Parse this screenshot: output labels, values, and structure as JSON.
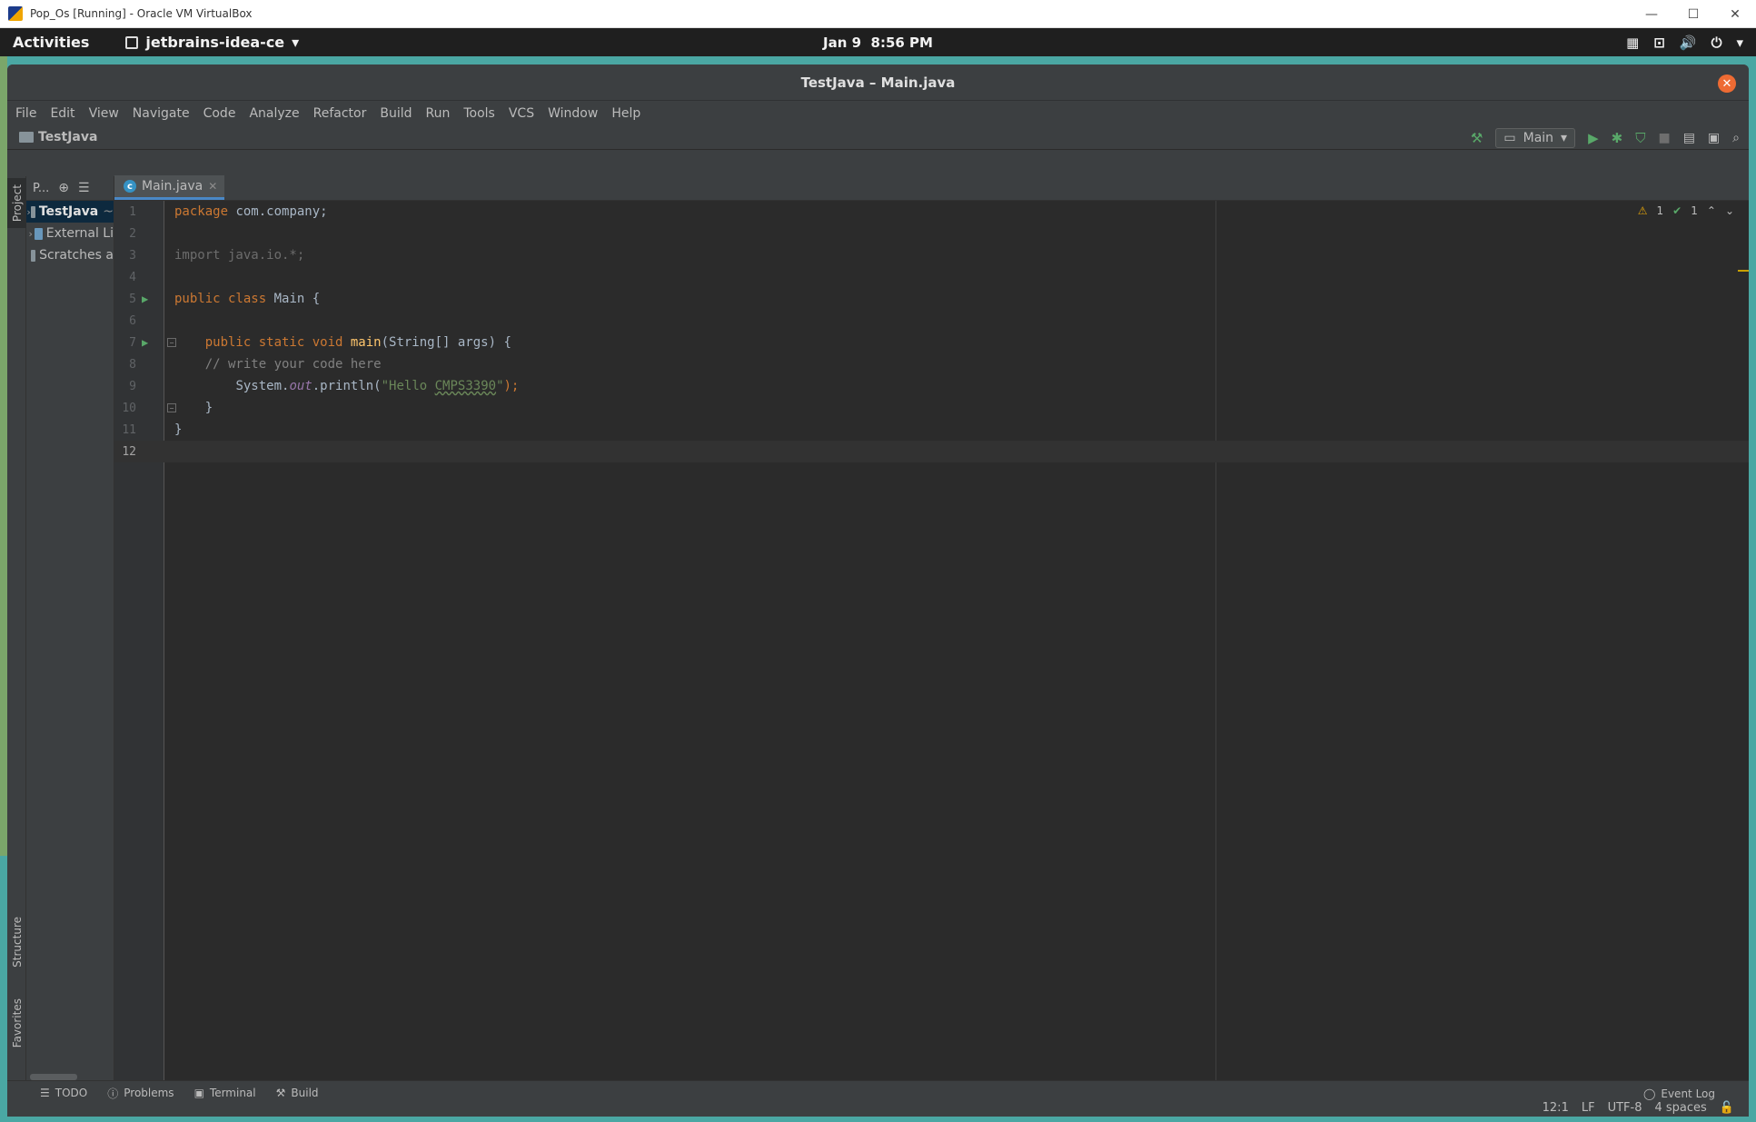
{
  "vbox": {
    "title": "Pop_Os [Running] - Oracle VM VirtualBox",
    "minimize": "—",
    "maximize": "☐",
    "close": "✕"
  },
  "gnome": {
    "activities": "Activities",
    "app_menu": "jetbrains-idea-ce",
    "clock_date": "Jan 9",
    "clock_time": "8:56 PM"
  },
  "ide": {
    "window_title": "TestJava – Main.java",
    "menu": [
      "File",
      "Edit",
      "View",
      "Navigate",
      "Code",
      "Analyze",
      "Refactor",
      "Build",
      "Run",
      "Tools",
      "VCS",
      "Window",
      "Help"
    ],
    "breadcrumb": "TestJava",
    "run_config": "Main",
    "project_panel": {
      "label": "P...",
      "vtab_project": "Project",
      "vtab_structure": "Structure",
      "vtab_favorites": "Favorites",
      "tree": [
        {
          "label": "TestJava",
          "suffix": "~",
          "selected": true,
          "expandable": true,
          "icon_color": "#87939a"
        },
        {
          "label": "External Li",
          "expandable": true,
          "icon_color": "#6897bb"
        },
        {
          "label": "Scratches a",
          "expandable": false,
          "icon_color": "#87939a"
        }
      ]
    },
    "editor": {
      "tab_label": "Main.java",
      "inspection_warnings": "1",
      "inspection_ok": "1",
      "line_numbers": [
        "1",
        "2",
        "3",
        "4",
        "5",
        "6",
        "7",
        "8",
        "9",
        "10",
        "11",
        "12"
      ],
      "code": {
        "l1_kw": "package",
        "l1_rest": " com.company;",
        "l3": "import java.io.*;",
        "l5_kw": "public class",
        "l5_rest": " Main {",
        "l7_kw": "public static void",
        "l7_fn": "main",
        "l7_rest": "(String[] args) {",
        "l8": "// write your code here",
        "l9_a": "System.",
        "l9_field": "out",
        "l9_b": ".println(",
        "l9_str_a": "\"Hello ",
        "l9_str_typo": "CMPS3390",
        "l9_str_b": "\"",
        "l9_end": ");",
        "l10": "}",
        "l11": "}"
      }
    },
    "bottom_tools": {
      "todo": "TODO",
      "problems": "Problems",
      "terminal": "Terminal",
      "build": "Build",
      "event_log": "Event Log"
    },
    "status": {
      "position": "12:1",
      "line_sep": "LF",
      "encoding": "UTF-8",
      "indent": "4 spaces"
    }
  }
}
